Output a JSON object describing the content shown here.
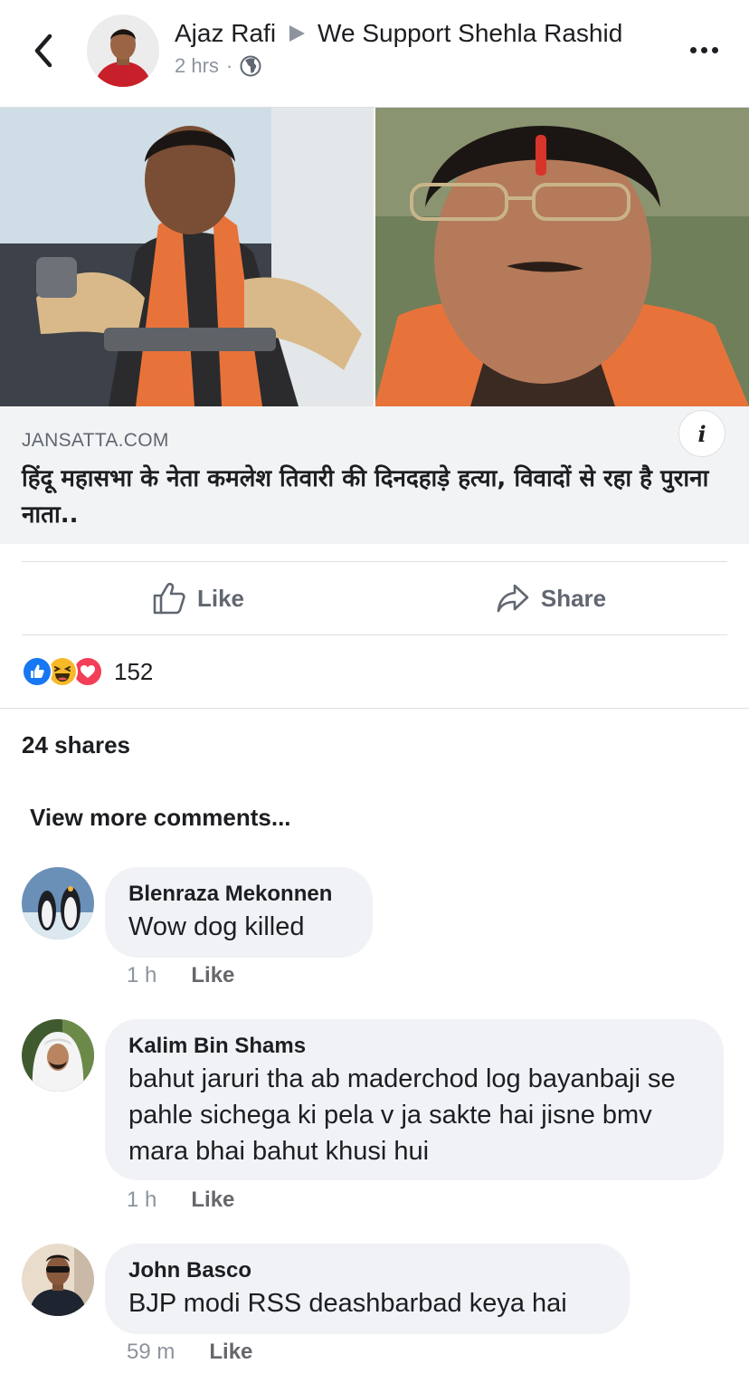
{
  "header": {
    "author": "Ajaz Rafi",
    "group": "We Support Shehla Rashid",
    "time": "2 hrs",
    "separator": "·"
  },
  "link_preview": {
    "domain": "JANSATTA.COM",
    "title": "हिंदू महासभा के नेता कमलेश तिवारी की दिनदहाड़े हत्या, विवादों से रहा है पुराना नाता..",
    "info_glyph": "i"
  },
  "actions": {
    "like_label": "Like",
    "share_label": "Share"
  },
  "reactions": {
    "icons": [
      "like-reaction",
      "haha-reaction",
      "love-reaction"
    ],
    "count": "152"
  },
  "shares_text": "24 shares",
  "view_more_label": "View more comments...",
  "comments": [
    {
      "name": "Blenraza Mekonnen",
      "text": "Wow dog killed",
      "time": "1 h",
      "like_label": "Like"
    },
    {
      "name": "Kalim Bin Shams",
      "text": "bahut jaruri tha ab maderchod log bayanbaji se pahle sichega ki pela v ja sakte hai jisne bmv mara bhai bahut khusi hui",
      "time": "1 h",
      "like_label": "Like"
    },
    {
      "name": "John Basco",
      "text": "BJP modi RSS deashbarbad keya hai",
      "time": "59 m",
      "like_label": "Like"
    }
  ],
  "colors": {
    "like_blue": "#1877f2",
    "haha_yellow": "#f7b928",
    "love_red": "#f33e58",
    "saffron": "#e8733a"
  }
}
